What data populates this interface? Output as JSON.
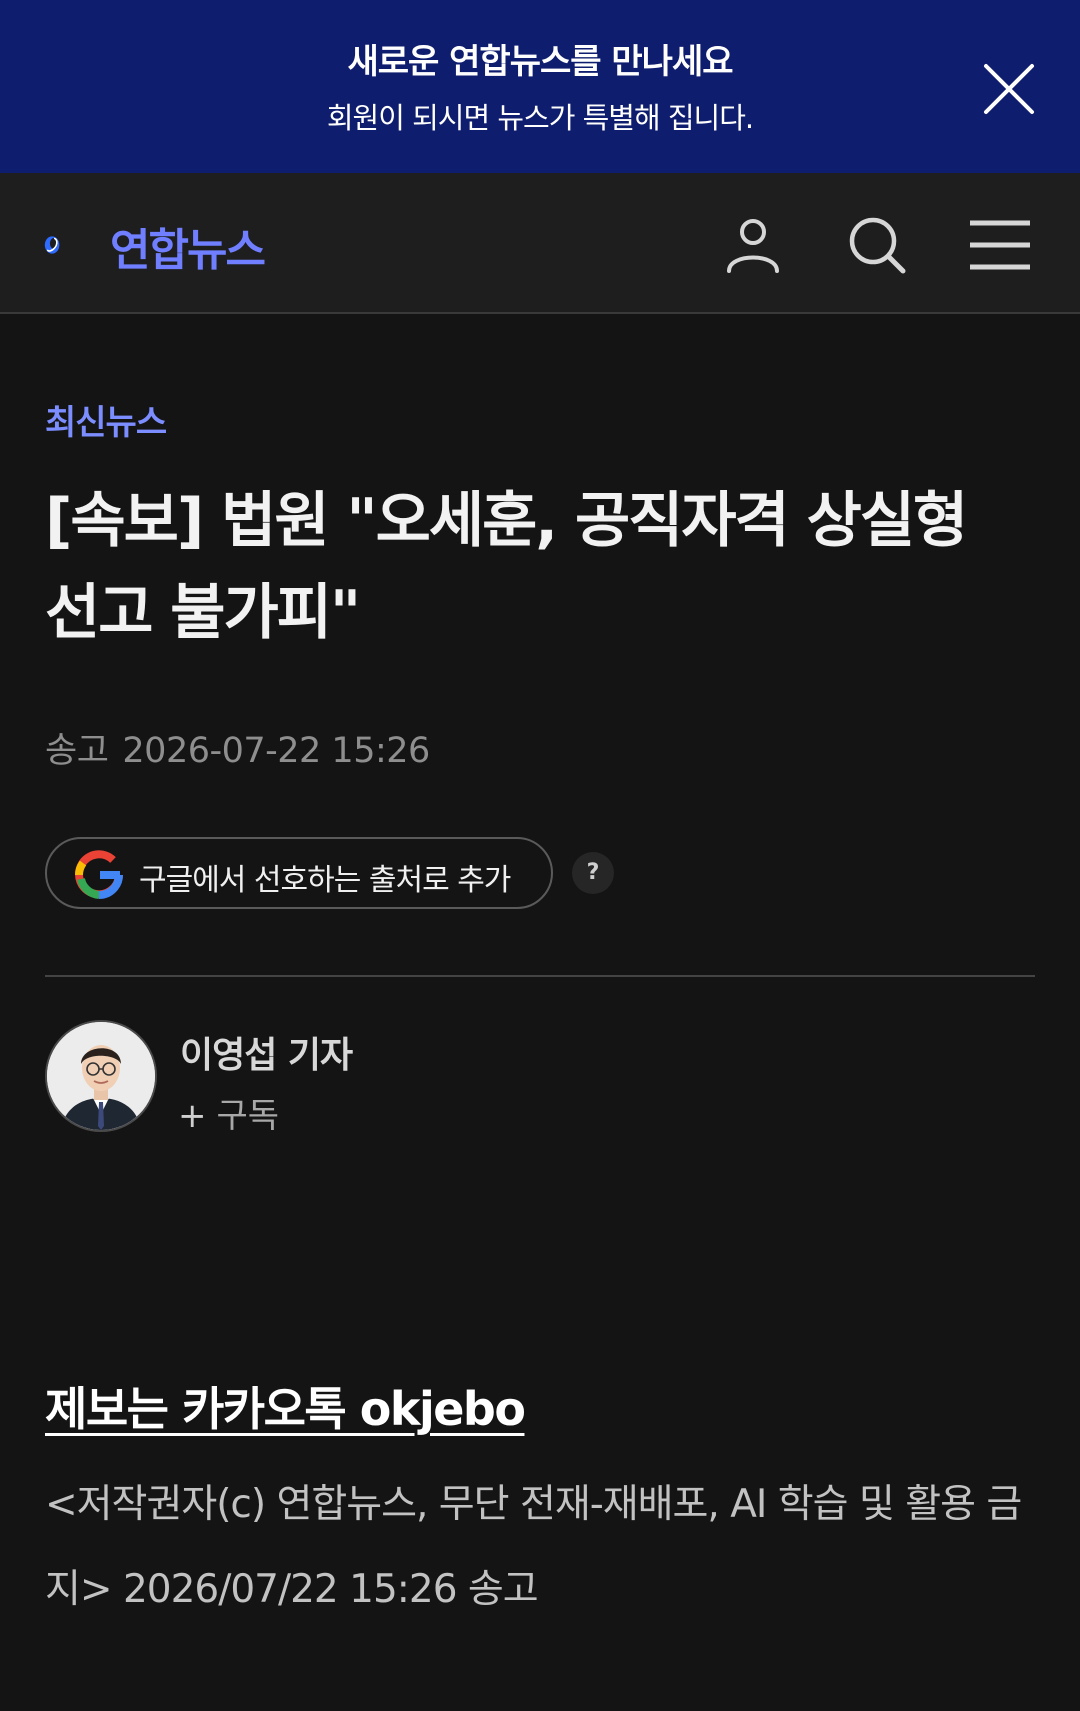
{
  "banner": {
    "title": "새로운 연합뉴스를 만나세요",
    "subtitle": "회원이 되시면 뉴스가 특별해 집니다."
  },
  "header": {
    "logo_text": "연합뉴스",
    "brand_color": "#6f7fff"
  },
  "article": {
    "category": "최신뉴스",
    "headline": "[속보] 법원 \"오세훈, 공직자격 상실형 선고 불가피\"",
    "published_label": "송고",
    "published_time": "2026-07-22 15:26",
    "google_button_label": "구글에서 선호하는 출처로 추가",
    "help_label": "?"
  },
  "reporter": {
    "name": "이영섭 기자",
    "subscribe_plus": "+",
    "subscribe_label": "구독"
  },
  "footer": {
    "tip_link": "제보는 카카오톡 okjebo",
    "copyright": "<저작권자(c) 연합뉴스, 무단 전재-재배포, AI 학습 및 활용 금지> 2026/07/22 15:26 송고"
  },
  "colors": {
    "banner_bg": "#0f1d6e",
    "page_bg": "#141414",
    "header_bg": "#1e1e1e",
    "category": "#7b8dff"
  },
  "icons": {
    "close": "close-icon",
    "user": "user-icon",
    "search": "search-icon",
    "menu": "menu-icon",
    "google": "google-icon"
  }
}
